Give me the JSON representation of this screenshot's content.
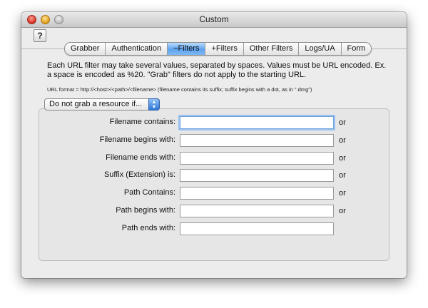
{
  "window": {
    "title": "Custom"
  },
  "toolbar": {
    "help_label": "?"
  },
  "tabs": [
    {
      "label": "Grabber",
      "active": false
    },
    {
      "label": "Authentication",
      "active": false
    },
    {
      "label": "−Filters",
      "active": true
    },
    {
      "label": "+Filters",
      "active": false
    },
    {
      "label": "Other Filters",
      "active": false
    },
    {
      "label": "Logs/UA",
      "active": false
    },
    {
      "label": "Form",
      "active": false
    }
  ],
  "description": "Each URL filter may take several values, separated by spaces. Values must be URL encoded. Ex. a space is encoded as %20.  \"Grab\" filters do not apply to the starting URL.",
  "format_hint": "URL format = http://<host>/<path>/<filename> (filename contains its suffix; suffix begins with a dot, as in \".dmg\")",
  "filter_popup": {
    "selected": "Do not grab a resource if..."
  },
  "filters": [
    {
      "label": "Filename contains:",
      "value": "",
      "connector": "or"
    },
    {
      "label": "Filename begins with:",
      "value": "",
      "connector": "or"
    },
    {
      "label": "Filename ends with:",
      "value": "",
      "connector": "or"
    },
    {
      "label": "Suffix (Extension) is:",
      "value": "",
      "connector": "or"
    },
    {
      "label": "Path Contains:",
      "value": "",
      "connector": "or"
    },
    {
      "label": "Path begins with:",
      "value": "",
      "connector": "or"
    },
    {
      "label": "Path ends with:",
      "value": "",
      "connector": ""
    }
  ],
  "colors": {
    "active_tab": "#5fa3ee",
    "focus_ring": "#9cc3f0"
  }
}
